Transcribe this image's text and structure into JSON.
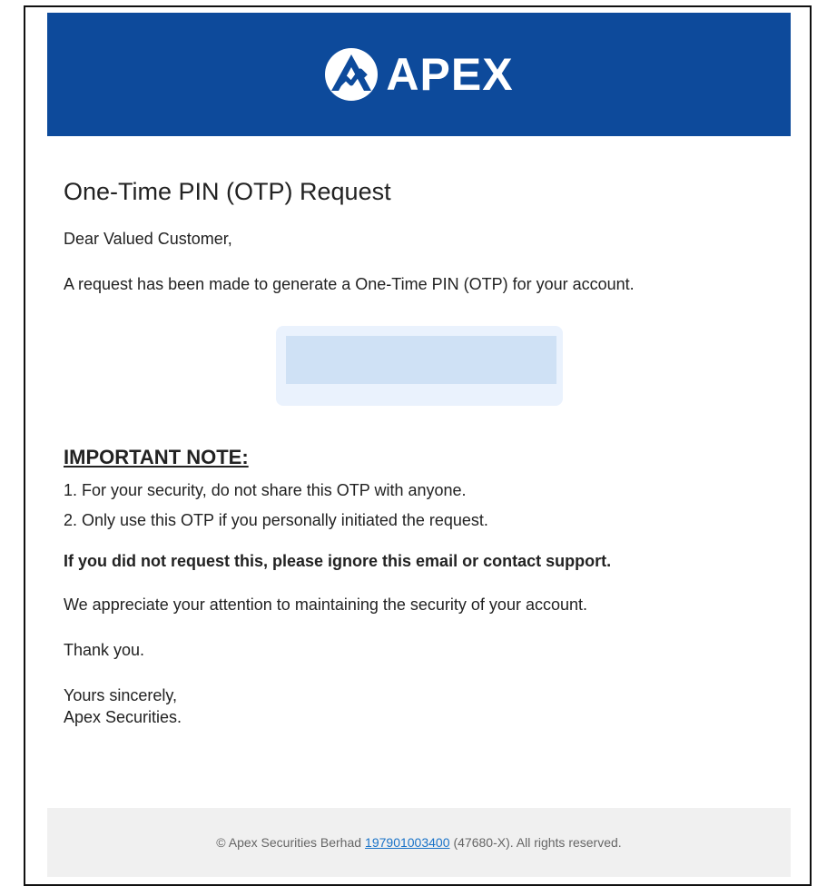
{
  "colors": {
    "header_bg": "#0d4a9b",
    "otp_outer": "#eaf2fd",
    "otp_inner": "#cfe1f5",
    "footer_bg": "#f0f0f0",
    "link": "#1a73c8"
  },
  "header": {
    "logo_icon": "apex-mountain-logo-icon",
    "brand": "APEX"
  },
  "email": {
    "title": "One-Time PIN (OTP) Request",
    "greeting": "Dear Valued Customer,",
    "intro": "A request has been made to generate a One-Time PIN (OTP) for your account.",
    "important_heading": "IMPORTANT NOTE:",
    "notes": [
      "1. For your security, do not share this OTP with anyone.",
      "2. Only use this OTP if you personally initiated the request."
    ],
    "warning": "If you did not request this, please ignore this email or contact support.",
    "appreciation": "We appreciate your attention to maintaining the security of your account.",
    "thanks": "Thank you.",
    "sign_off": "Yours sincerely,",
    "signature": "Apex Securities."
  },
  "footer": {
    "prefix": "© Apex Securities Berhad",
    "reg_link": "197901003400",
    "suffix": "(47680-X). All rights reserved."
  }
}
